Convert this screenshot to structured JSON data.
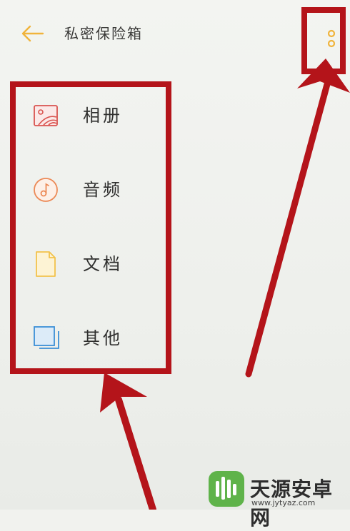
{
  "header": {
    "title": "私密保险箱",
    "back_icon": "back-arrow-icon",
    "more_icon": "more-vertical-icon",
    "accent_color": "#f0b43c"
  },
  "menu": {
    "items": [
      {
        "label": "相册",
        "icon": "album-icon",
        "color": "#d9534f"
      },
      {
        "label": "音频",
        "icon": "audio-icon",
        "color": "#ec8a57"
      },
      {
        "label": "文档",
        "icon": "document-icon",
        "color": "#f2c24b"
      },
      {
        "label": "其他",
        "icon": "other-icon",
        "color": "#3b8fd6"
      }
    ]
  },
  "annotation_color": "#b4141a",
  "watermark": {
    "text": "天源安卓网",
    "url": "www.jytyaz.com"
  }
}
